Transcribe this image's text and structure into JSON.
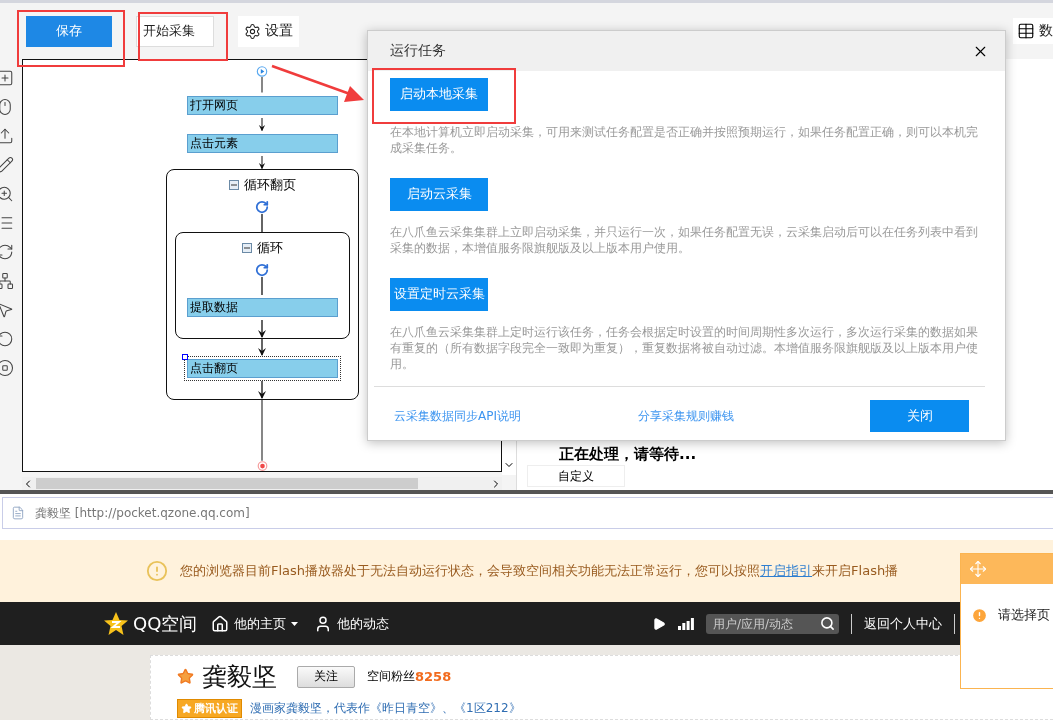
{
  "toolbar": {
    "buttons": [
      {
        "label": "保存",
        "kind": "primary"
      },
      {
        "label": "开始采集",
        "kind": "outline"
      },
      {
        "label": "设置",
        "kind": "settings"
      }
    ],
    "right_label": "数"
  },
  "workflow": {
    "steps": [
      {
        "kind": "action",
        "label": "打开网页",
        "selected": false
      },
      {
        "kind": "action",
        "label": "点击元素",
        "selected": false
      },
      {
        "kind": "loop",
        "label": "循环翻页",
        "selected": false,
        "expanded": true,
        "children": [
          {
            "kind": "loop",
            "label": "循环",
            "selected": false,
            "expanded": true,
            "children": [
              {
                "kind": "action",
                "label": "提取数据",
                "selected": false
              }
            ]
          },
          {
            "kind": "action",
            "label": "点击翻页",
            "selected": true
          }
        ]
      }
    ]
  },
  "right_panel": {
    "custom_tab": "自定义",
    "status": "正在处理，请等待..."
  },
  "dialog": {
    "title": "运行任务",
    "options": [
      {
        "button": "启动本地采集",
        "description": "在本地计算机立即启动采集，可用来测试任务配置是否正确并按照预期运行，如果任务配置正确，则可以本机完成采集任务。"
      },
      {
        "button": "启动云采集",
        "description": "在八爪鱼云采集集群上立即启动采集，并只运行一次，如果任务配置无误，云采集启动后可以在任务列表中看到采集的数据，本增值服务限旗舰版及以上版本用户使用。"
      },
      {
        "button": "设置定时云采集",
        "description": "在八爪鱼云采集集群上定时运行该任务，任务会根据定时设置的时间周期性多次运行，多次运行采集的数据如果有重复的（所有数据字段完全一致即为重复），重复数据将被自动过滤。本增值服务限旗舰版及以上版本用户使用。"
      }
    ],
    "links": [
      "云采集数据同步API说明",
      "分享采集规则赚钱"
    ],
    "close_button": "关闭"
  },
  "browser": {
    "address": "龚毅坚 [http://pocket.qzone.qq.com]",
    "notice": {
      "before": "您的浏览器目前Flash播放器处于无法自动运行状态，会导致空间相关功能无法正常运行，您可以按照",
      "link": "开启指引",
      "after": "来开启Flash播"
    },
    "nav": {
      "logo": "QQ空间",
      "items": [
        {
          "kind": "home",
          "label": "他的主页"
        },
        {
          "kind": "feed",
          "label": "他的动态"
        }
      ],
      "search_placeholder": "用户/应用/动态",
      "back": "返回个人中心"
    },
    "profile": {
      "name": "龚毅坚",
      "follow": "关注",
      "fans_label": "空间粉丝",
      "fans_count": "8258",
      "badge": "腾讯认证",
      "bio": "漫画家龚毅坚，代表作《昨日青空》、《1区212》"
    },
    "popup": {
      "message": "请选择页"
    }
  }
}
